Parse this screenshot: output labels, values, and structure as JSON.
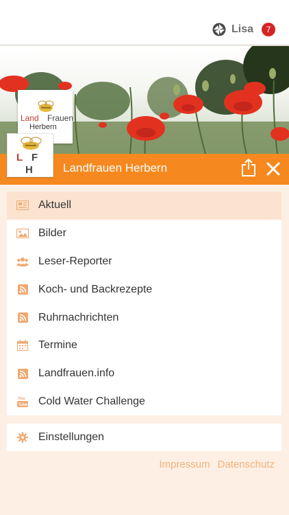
{
  "topbar": {
    "user_name": "Lisa",
    "badge_count": "7",
    "user_icon": "app-logo-icon"
  },
  "brand": {
    "logo_word_1": "Land",
    "logo_word_2": "Frauen",
    "logo_word_3": "Herbern",
    "small_logo_letters": [
      "L",
      "F",
      "H"
    ]
  },
  "header": {
    "title": "Landfrauen Herbern",
    "share_icon": "share-icon",
    "close_icon": "close-icon"
  },
  "menu": {
    "items": [
      {
        "label": "Aktuell",
        "icon": "newspaper-icon",
        "active": true
      },
      {
        "label": "Bilder",
        "icon": "image-icon"
      },
      {
        "label": "Leser-Reporter",
        "icon": "users-icon"
      },
      {
        "label": "Koch- und Backrezepte",
        "icon": "rss-icon"
      },
      {
        "label": "Ruhrnachrichten",
        "icon": "rss-icon"
      },
      {
        "label": "Termine",
        "icon": "calendar-icon"
      },
      {
        "label": "Landfrauen.info",
        "icon": "rss-icon"
      },
      {
        "label": "Cold Water Challenge",
        "icon": "youtube-icon"
      }
    ]
  },
  "settings": {
    "label": "Einstellungen",
    "icon": "gear-icon"
  },
  "footer": {
    "links": [
      "Impressum",
      "Datenschutz"
    ]
  },
  "colors": {
    "accent": "#f5891f",
    "active_item_bg": "#fce3d0",
    "badge": "#d62424",
    "footer_link": "#f2b27a",
    "page_bg": "#fdefe4"
  }
}
